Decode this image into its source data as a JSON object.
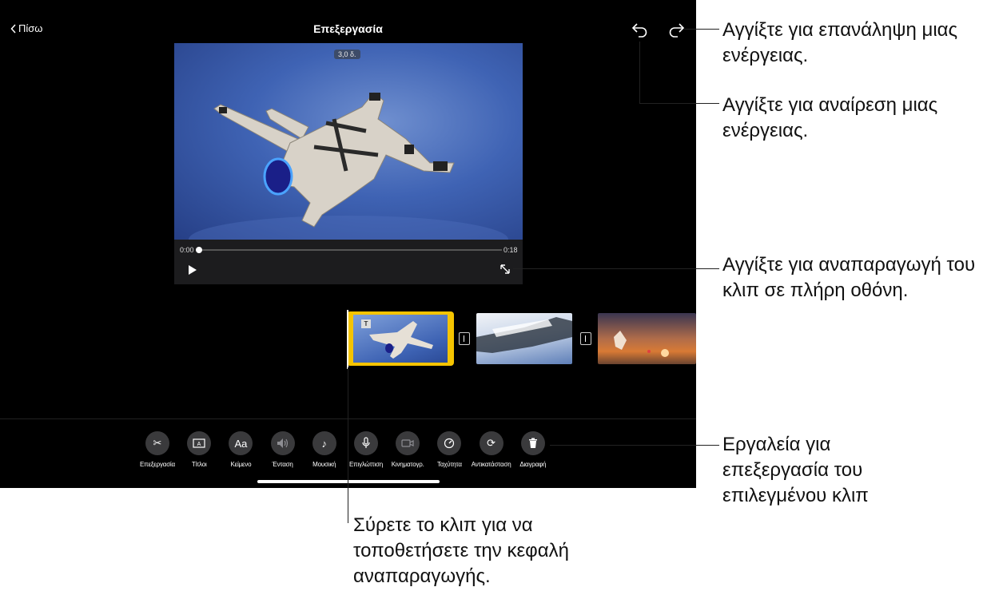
{
  "header": {
    "back_label": "Πίσω",
    "title": "Επεξεργασία"
  },
  "viewer": {
    "duration_tag": "3,0 δ.",
    "time_start": "0:00",
    "time_end": "0:18",
    "progress": 0
  },
  "toolbar": {
    "items": [
      {
        "label": "Επεξεργασία",
        "icon": "scissors-icon"
      },
      {
        "label": "Τίτλοι",
        "icon": "titles-icon"
      },
      {
        "label": "Κείμενο",
        "icon": "text-icon"
      },
      {
        "label": "Ένταση",
        "icon": "volume-icon"
      },
      {
        "label": "Μουσική",
        "icon": "music-note-icon"
      },
      {
        "label": "Επιγλώττιση",
        "icon": "microphone-icon"
      },
      {
        "label": "Κινηματογρ.",
        "icon": "cinematic-icon"
      },
      {
        "label": "Ταχύτητα",
        "icon": "speed-icon"
      },
      {
        "label": "Αντικατάσταση",
        "icon": "replace-icon"
      },
      {
        "label": "Διαγραφή",
        "icon": "trash-icon"
      }
    ]
  },
  "callouts": {
    "redo": "Αγγίξτε για επανάληψη μιας ενέργειας.",
    "undo": "Αγγίξτε για αναίρεση μιας ενέργειας.",
    "fullscreen": "Αγγίξτε για αναπαραγωγή του κλιπ σε πλήρη οθόνη.",
    "tools": "Εργαλεία για επεξεργασία του επιλεγμένου κλιπ",
    "playhead": "Σύρετε το κλιπ για να τοποθετήσετε την κεφαλή αναπαραγωγής."
  }
}
